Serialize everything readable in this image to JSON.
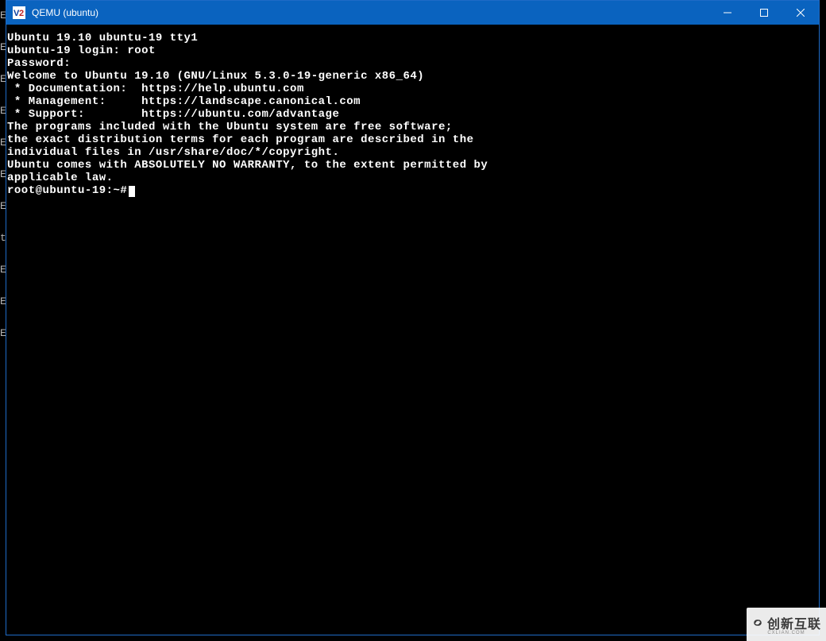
{
  "window": {
    "title": "QEMU (ubuntu)"
  },
  "left_strip_chars": [
    "E",
    "E",
    "E",
    "E",
    "E",
    "E",
    "E",
    "t",
    "E",
    "E",
    "E",
    "",
    "",
    "",
    "",
    "",
    ""
  ],
  "terminal": {
    "lines": [
      "Ubuntu 19.10 ubuntu-19 tty1",
      "",
      "ubuntu-19 login: root",
      "Password:",
      "Welcome to Ubuntu 19.10 (GNU/Linux 5.3.0-19-generic x86_64)",
      "",
      " * Documentation:  https://help.ubuntu.com",
      " * Management:     https://landscape.canonical.com",
      " * Support:        https://ubuntu.com/advantage",
      "",
      "The programs included with the Ubuntu system are free software;",
      "the exact distribution terms for each program are described in the",
      "individual files in /usr/share/doc/*/copyright.",
      "",
      "Ubuntu comes with ABSOLUTELY NO WARRANTY, to the extent permitted by",
      "applicable law.",
      "",
      "root@ubuntu-19:~#"
    ],
    "prompt_has_cursor": true
  },
  "watermark": {
    "main": "创新互联",
    "sub": "CXLIAN.COM"
  }
}
